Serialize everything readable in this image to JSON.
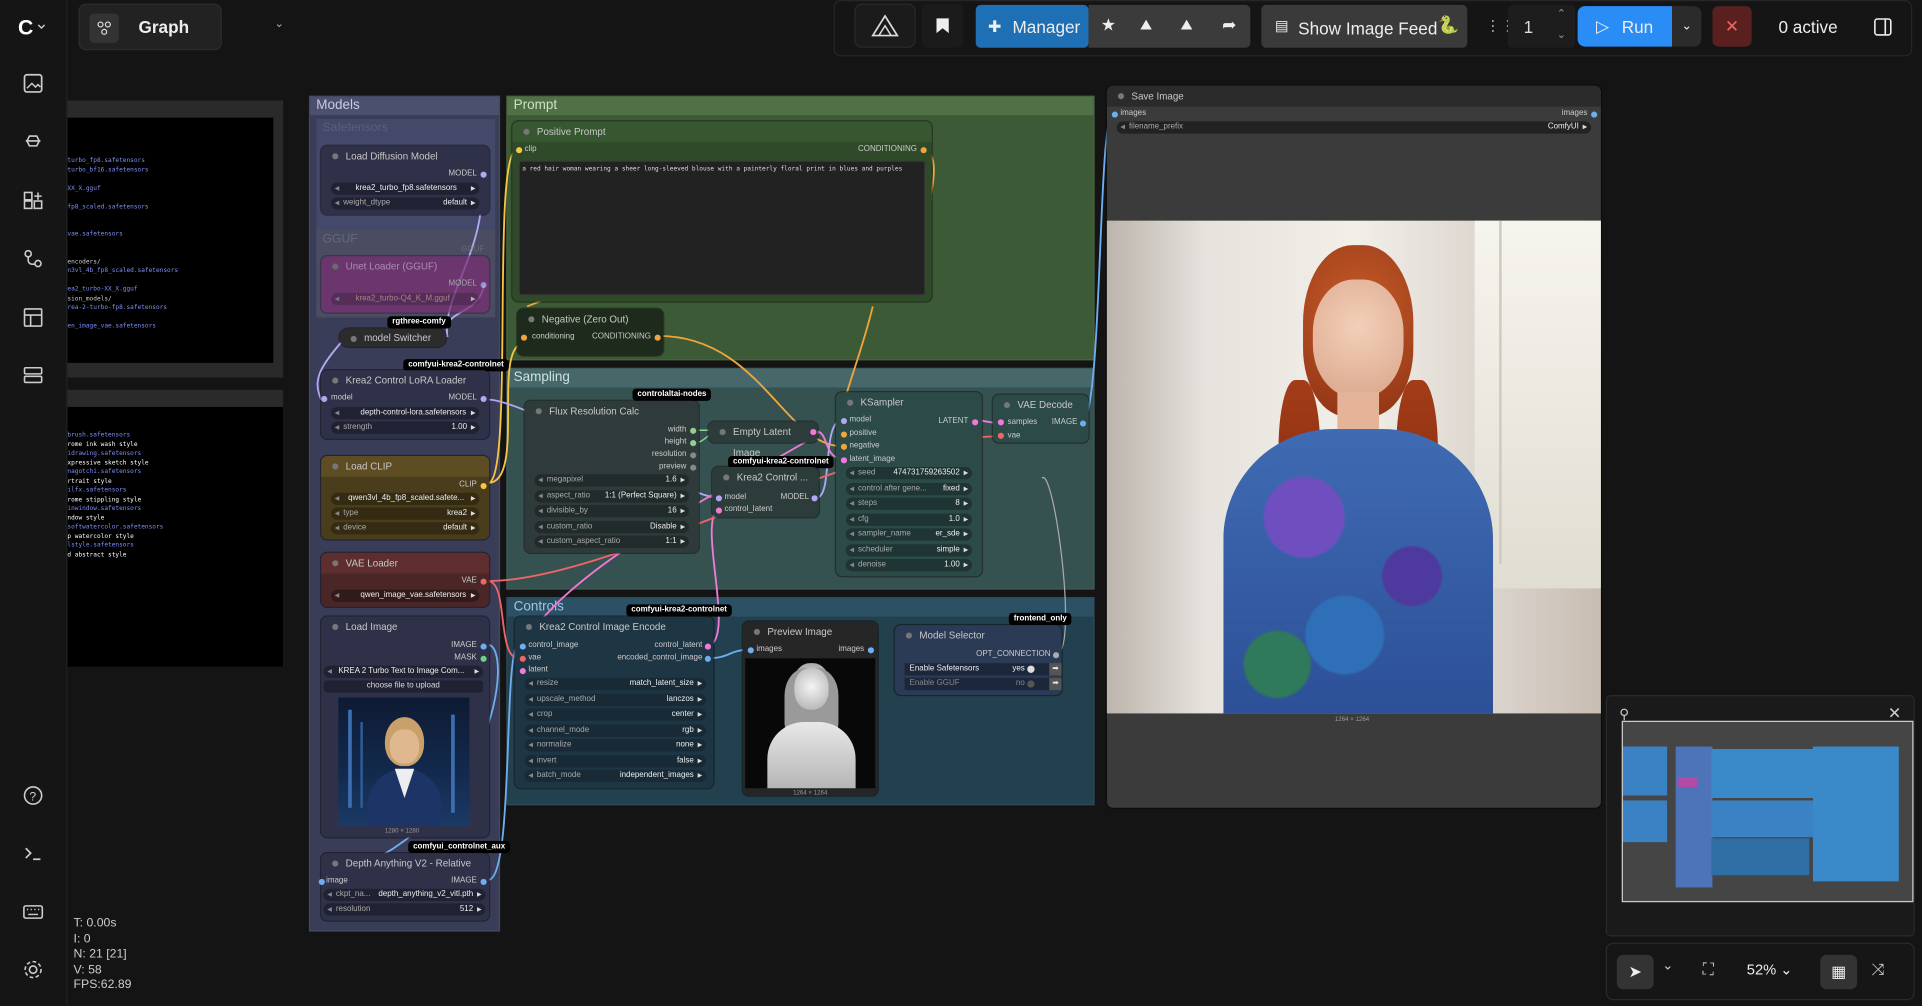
{
  "app": {
    "view_name": "Graph"
  },
  "toolbar": {
    "manager_label": "Manager",
    "show_image_feed_label": "Show Image Feed",
    "queue_count": "1",
    "run_label": "Run",
    "active_label": "0 active"
  },
  "groups": {
    "models": "Models",
    "prompt": "Prompt",
    "sampling": "Sampling",
    "controls": "Controls",
    "safetensors": "Safetensors",
    "gguf": "GGUF"
  },
  "nodes": {
    "load_diffusion": {
      "title": "Load Diffusion Model",
      "out": "MODEL",
      "unet": "krea2_turbo_fp8.safetensors",
      "dtype_label": "weight_dtype",
      "dtype": "default"
    },
    "unet_gguf": {
      "title": "Unet Loader (GGUF)",
      "tag": "GGUF",
      "out": "MODEL",
      "model": "krea2_turbo-Q4_K_M.gguf"
    },
    "switcher": {
      "title": "model Switcher",
      "tag": "rgthree-comfy"
    },
    "lora": {
      "title": "Krea2 Control LoRA Loader",
      "tag": "comfyui-krea2-controlnet",
      "in": "model",
      "out": "MODEL",
      "lora": "depth-control-lora.safetensors",
      "strength_label": "strength",
      "strength": "1.00"
    },
    "clip": {
      "title": "Load CLIP",
      "out": "CLIP",
      "clip_name": "qwen3vl_4b_fp8_scaled.safete...",
      "type_label": "type",
      "type": "krea2",
      "device_label": "device",
      "device": "default"
    },
    "vae": {
      "title": "VAE Loader",
      "out": "VAE",
      "vae_name": "qwen_image_vae.safetensors"
    },
    "load_image": {
      "title": "Load Image",
      "out1": "IMAGE",
      "out2": "MASK",
      "file": "KREA 2 Turbo Text to Image Com...",
      "upload": "choose file to upload",
      "size": "1280 × 1280"
    },
    "depth": {
      "title": "Depth Anything V2 - Relative",
      "tag": "comfyui_controlnet_aux",
      "in": "image",
      "out": "IMAGE",
      "ckpt_label": "ckpt_na...",
      "ckpt": "depth_anything_v2_vitl.pth",
      "res_label": "resolution",
      "res": "512"
    },
    "positive": {
      "title": "Positive Prompt",
      "in": "clip",
      "out": "CONDITIONING",
      "text": "a red hair woman wearing a sheer long-sleeved blouse with a painterly floral print in blues and purples"
    },
    "negative": {
      "title": "Negative (Zero Out)",
      "in": "conditioning",
      "out": "CONDITIONING"
    },
    "flux_res": {
      "title": "Flux Resolution Calc",
      "tag": "controlaltai-nodes",
      "outs": [
        "width",
        "height",
        "resolution",
        "preview"
      ],
      "widgets": [
        [
          "megapixel",
          "1.6"
        ],
        [
          "aspect_ratio",
          "1:1 (Perfect Square)"
        ],
        [
          "divisible_by",
          "16"
        ],
        [
          "custom_ratio",
          "Disable"
        ],
        [
          "custom_aspect_ratio",
          "1:1"
        ]
      ]
    },
    "empty_latent": {
      "title": "Empty Latent Image"
    },
    "krea_control": {
      "title": "Krea2 Control ...",
      "tag": "comfyui-krea2-controlnet",
      "in1": "model",
      "in2": "control_latent",
      "out": "MODEL"
    },
    "ksampler": {
      "title": "KSampler",
      "ins": [
        "model",
        "positive",
        "negative",
        "latent_image"
      ],
      "out": "LATENT",
      "widgets": [
        [
          "seed",
          "474731759263502"
        ],
        [
          "control after gene...",
          "fixed"
        ],
        [
          "steps",
          "8"
        ],
        [
          "cfg",
          "1.0"
        ],
        [
          "sampler_name",
          "er_sde"
        ],
        [
          "scheduler",
          "simple"
        ],
        [
          "denoise",
          "1.00"
        ]
      ]
    },
    "vae_decode": {
      "title": "VAE Decode",
      "in1": "samples",
      "in2": "vae",
      "out": "IMAGE"
    },
    "encode": {
      "title": "Krea2 Control Image Encode",
      "tag": "comfyui-krea2-controlnet",
      "ins": [
        "control_image",
        "vae",
        "latent"
      ],
      "outs": [
        "control_latent",
        "encoded_control_image"
      ],
      "widgets": [
        [
          "resize",
          "match_latent_size"
        ],
        [
          "upscale_method",
          "lanczos"
        ],
        [
          "crop",
          "center"
        ],
        [
          "channel_mode",
          "rgb"
        ],
        [
          "normalize",
          "none"
        ],
        [
          "invert",
          "false"
        ],
        [
          "batch_mode",
          "independent_images"
        ]
      ]
    },
    "preview": {
      "title": "Preview Image",
      "in": "images",
      "out": "images",
      "size": "1264 × 1264"
    },
    "model_selector": {
      "title": "Model Selector",
      "tag": "frontend_only",
      "out": "OPT_CONNECTION",
      "opt1_label": "Enable Safetensors",
      "opt1": "yes",
      "opt2_label": "Enable GGUF",
      "opt2": "no"
    },
    "save": {
      "title": "Save Image",
      "in": "images",
      "out": "images",
      "prefix_label": "filename_prefix",
      "prefix": "ComfyUI",
      "size": "1264 × 1264"
    }
  },
  "terminal1": [
    "turbo_fp8.safetensors",
    "turbo_bf16.safetensors",
    "",
    "XX_X.gguf",
    "",
    "fp8_scaled.safetensors",
    "",
    "",
    "vae.safetensors",
    "",
    "",
    "encoders/",
    "n3vl_4b_fp8_scaled.safetensors",
    "",
    "ea2_turbo-XX_X.gguf",
    "sion_models/",
    "rea-2-turbo-fp8.safetensors",
    "",
    "en_image_vae.safetensors"
  ],
  "terminal2": [
    "brush.safetensors",
    "rome ink wash style",
    "idrawing.safetensors",
    "xpressive sketch style",
    "nagotchi.safetensors",
    "rtrait style",
    "ilfx.safetensors",
    "rome stippling style",
    "inwindow.safetensors",
    "ndow style",
    "softwatercolor.safetensors",
    "p watercolor style",
    "lstyle.safetensors",
    "d abstract style"
  ],
  "stats": {
    "t": "T: 0.00s",
    "i": "I: 0",
    "n": "N: 21 [21]",
    "v": "V: 58",
    "fps": "FPS:62.89"
  },
  "zoom": "52%",
  "colors": {
    "run": "#2a8cf5",
    "manager": "#1f6fb5",
    "prompt_group": "#3d5a36",
    "models_group": "#3a3d58",
    "sampling_group": "#365250",
    "controls_group": "#23404f",
    "clip_link": "#f5c543",
    "conditioning_link": "#f0a53c",
    "vae_link": "#f06565",
    "image_link": "#6eaef0",
    "latent_link": "#f07ad8"
  }
}
